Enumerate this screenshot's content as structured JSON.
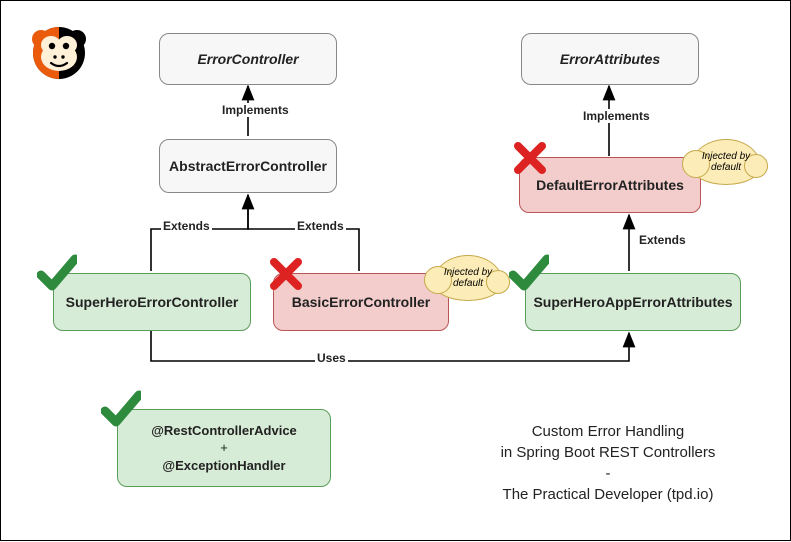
{
  "boxes": {
    "errorController": "ErrorController",
    "errorAttributes": "ErrorAttributes",
    "abstractErrorController": "AbstractErrorController",
    "defaultErrorAttributes": "DefaultErrorAttributes",
    "superHeroErrorController": "SuperHeroErrorController",
    "basicErrorController": "BasicErrorController",
    "superHeroAppErrorAttributes": "SuperHeroAppErrorAttributes",
    "advice_line1": "@RestControllerAdvice",
    "advice_plus": "+",
    "advice_line2": "@ExceptionHandler"
  },
  "edges": {
    "implements1": "Implements",
    "implements2": "Implements",
    "extends1": "Extends",
    "extends2": "Extends",
    "extends3": "Extends",
    "uses": "Uses"
  },
  "clouds": {
    "injected1": "Injected by default",
    "injected2": "Injected by default"
  },
  "caption": {
    "line1": "Custom Error Handling",
    "line2": "in Spring Boot REST Controllers",
    "line3": "-",
    "line4": "The Practical Developer (tpd.io)"
  }
}
